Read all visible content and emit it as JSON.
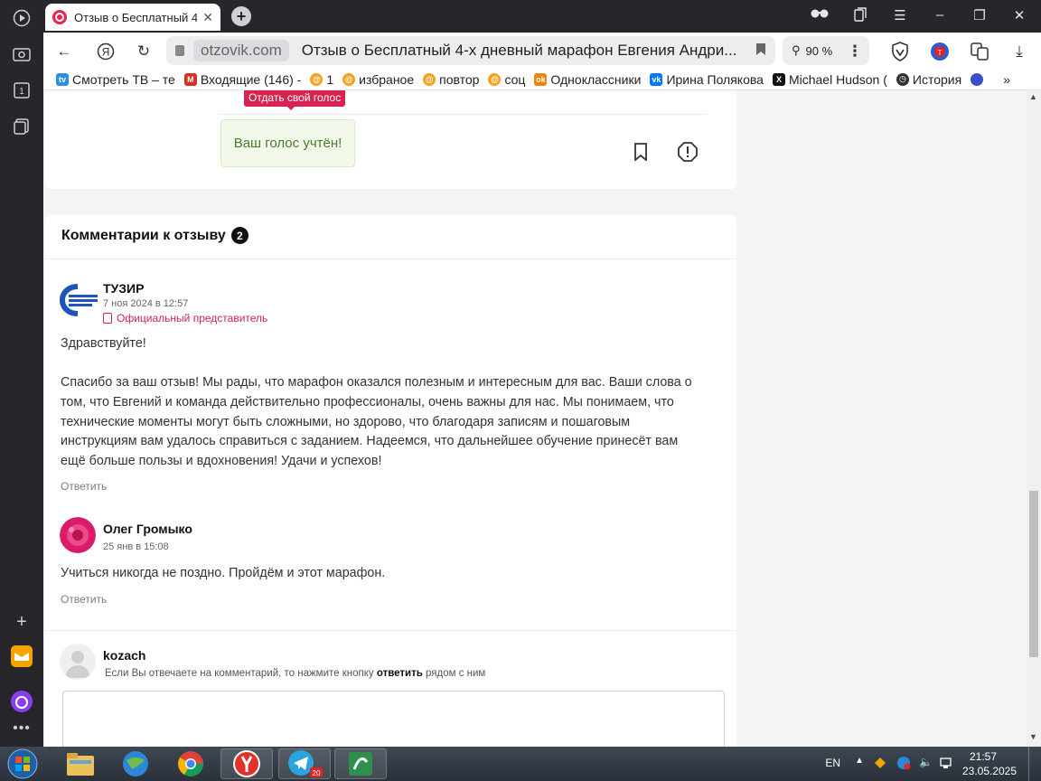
{
  "browser": {
    "tab_title": "Отзыв о Бесплатный 4-х дневный марафон Евгения Андри",
    "domain": "otzovik.com",
    "page_title": "Отзыв о Бесплатный 4-х дневный марафон Евгения Андри...",
    "zoom": "90 %",
    "bookmarks": [
      {
        "label": "Смотреть ТВ – те",
        "color": "#2f8ee0"
      },
      {
        "label": "Входящие (146) -",
        "color": "#d93025"
      },
      {
        "label": "1",
        "color": "#f3a21f"
      },
      {
        "label": "избраное",
        "color": "#f3a21f"
      },
      {
        "label": "повтор",
        "color": "#f3a21f"
      },
      {
        "label": "соц",
        "color": "#f3a21f"
      },
      {
        "label": "Одноклассники",
        "color": "#ee8208"
      },
      {
        "label": "Ирина Полякова",
        "color": "#0077ff"
      },
      {
        "label": "Michael Hudson (",
        "color": "#111111"
      },
      {
        "label": "История",
        "color": "#333333"
      }
    ]
  },
  "review": {
    "tooltip": "Отдать свой голос",
    "voted": "Ваш голос учтён!"
  },
  "comments": {
    "title": "Комментарии к отзыву",
    "count": "2",
    "items": [
      {
        "author": "ТУЗИР",
        "date": "7 ноя 2024 в 12:57",
        "badge": "Официальный представитель",
        "text1": "Здравствуйте!",
        "lines": [
          "Спасибо за ваш отзыв! Мы рады, что марафон оказался полезным и интересным для вас. Ваши слова о",
          "том, что Евгений и команда действительно профессионалы, очень важны для нас. Мы понимаем, что",
          "технические моменты могут быть сложными, но здорово, что благодаря записям и пошаговым",
          "инструкциям вам удалось справиться с заданием. Надеемся, что дальнейшее обучение принесёт вам",
          "ещё больше пользы и вдохновения! Удачи и успехов!"
        ],
        "reply": "Ответить"
      },
      {
        "author": "Олег Громыко",
        "date": "25 янв в 15:08",
        "text": "Учиться никогда не поздно. Пройдём и этот марафон.",
        "reply": "Ответить"
      }
    ],
    "new_comment": {
      "user": "kozach",
      "hint_before": "Если Вы отвечаете на комментарий, то нажмите кнопку ",
      "hint_bold": "ответить",
      "hint_after": " рядом с ним"
    }
  },
  "system": {
    "lang": "EN",
    "time": "21:57",
    "date": "23.05.2025",
    "telegram_badge": "20"
  }
}
